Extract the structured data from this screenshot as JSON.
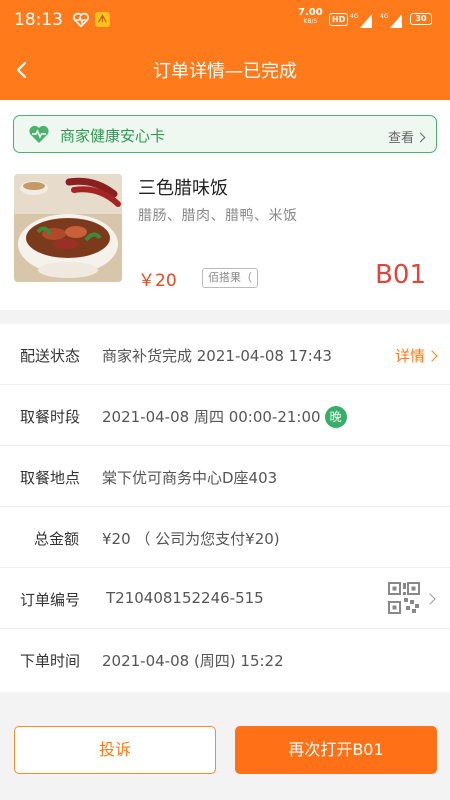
{
  "status_bar": {
    "time": "18:13",
    "net_speed": "7.00",
    "net_unit": "KB/S",
    "hd_label": "HD",
    "signal1": "4G",
    "signal2": "4G",
    "battery": "30",
    "icons": [
      "heart-health-icon",
      "app-notification-icon",
      "signal-icon",
      "battery-icon"
    ]
  },
  "header": {
    "title": "订单详情—已完成",
    "back_icon": "back-arrow-icon"
  },
  "health_card": {
    "label": "商家健康安心卡",
    "view_label": "查看",
    "color": "#49b26c"
  },
  "item": {
    "name": "三色腊味饭",
    "description": "腊肠、腊肉、腊鸭、米饭",
    "price": "￥20",
    "tag": "佰搭果（",
    "code": "B01"
  },
  "details": {
    "delivery_status": {
      "label": "配送状态",
      "value": "商家补货完成  2021-04-08 17:43",
      "link": "详情"
    },
    "pickup_time": {
      "label": "取餐时段",
      "value": "2021-04-08 周四 00:00-21:00",
      "badge": "晚"
    },
    "pickup_location": {
      "label": "取餐地点",
      "value": "棠下优可商务中心D座403"
    },
    "total": {
      "label": "总金额",
      "value": "¥20 （ 公司为您支付¥20)"
    },
    "order_no": {
      "label": "订单编号",
      "value": "T210408152246-515"
    },
    "order_time": {
      "label": "下单时间",
      "value": "2021-04-08  (周四)  15:22"
    }
  },
  "buttons": {
    "complain": "投诉",
    "reopen": "再次打开B01"
  },
  "colors": {
    "accent": "#ff7a1a",
    "price": "#e8491d",
    "code": "#e0443a",
    "green": "#37b067"
  }
}
